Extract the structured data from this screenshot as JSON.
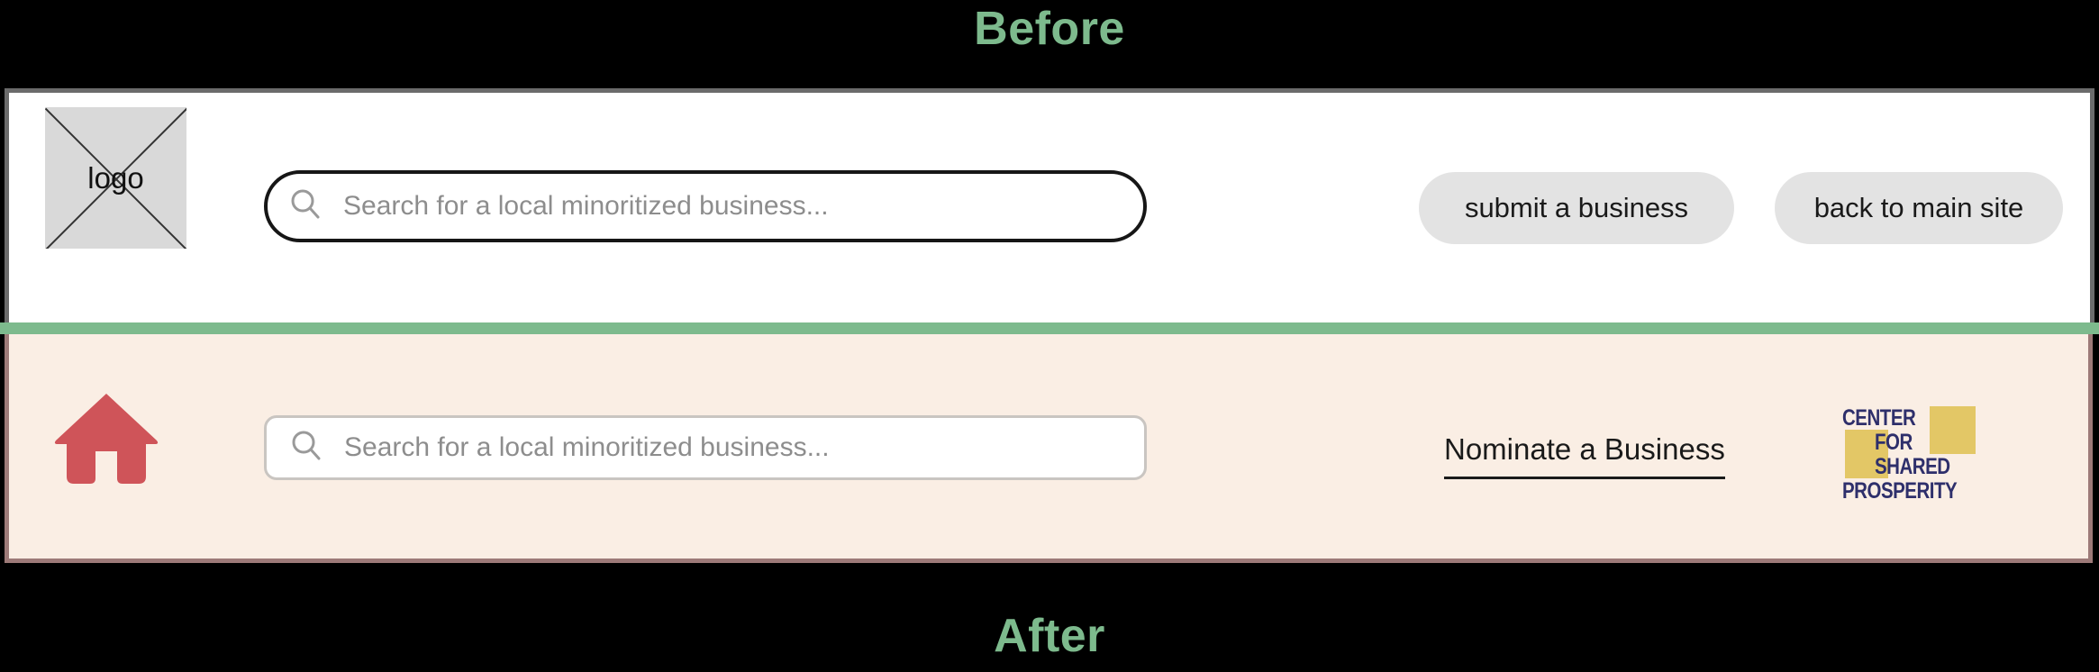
{
  "labels": {
    "before": "Before",
    "after": "After"
  },
  "colors": {
    "label_green": "#7dba8d",
    "divider_green": "#7dba8d",
    "before_bg": "#ffffff",
    "before_border": "#6b6b6b",
    "after_bg": "#faeee4",
    "after_border": "#9d7a78",
    "home_icon_red": "#cf5459",
    "pill_button_bg": "#e3e3e3",
    "logo_navy": "#2e2f6b",
    "logo_gold": "#e3c766",
    "placeholder_text": "#8d8d8d",
    "page_bg": "#000000"
  },
  "before": {
    "logo": {
      "text": "logo",
      "icon": "image-placeholder-x-icon"
    },
    "search": {
      "icon": "search-icon",
      "value": "",
      "placeholder": "Search for a local minoritized business..."
    },
    "buttons": [
      {
        "label": "submit a business"
      },
      {
        "label": "back to main site"
      }
    ]
  },
  "after": {
    "home": {
      "icon": "home-icon"
    },
    "search": {
      "icon": "search-icon",
      "value": "",
      "placeholder": "Search for a local minoritized business..."
    },
    "nominate_link": {
      "label": "Nominate a Business"
    },
    "brand_logo": {
      "icon": "center-for-shared-prosperity-logo",
      "lines": [
        "CENTER",
        "FOR",
        "SHARED",
        "PROSPERITY"
      ]
    }
  }
}
